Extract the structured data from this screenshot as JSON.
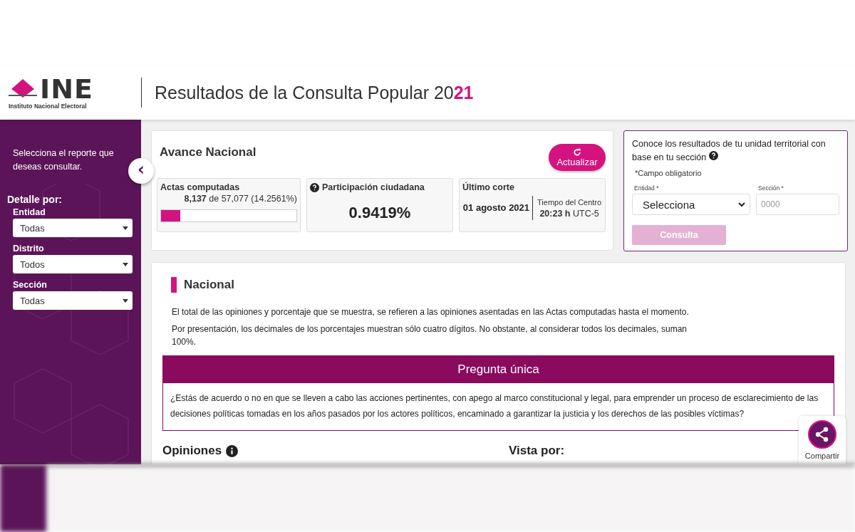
{
  "header": {
    "logo_text": "INE",
    "logo_caption": "Instituto Nacional Electoral",
    "title": "Resultados de la Consulta Popular 20",
    "title_accent": "21"
  },
  "sidebar": {
    "intro": "Selecciona el reporte que deseas consultar.",
    "collapse_icon": "‹",
    "heading": "Detalle por:",
    "filters": [
      {
        "label": "Entidad",
        "value": "Todas"
      },
      {
        "label": "Distrito",
        "value": "Todos"
      },
      {
        "label": "Sección",
        "value": "Todas"
      }
    ]
  },
  "avance": {
    "title": "Avance Nacional",
    "refresh_button": "Actualizar",
    "actas": {
      "label": "Actas computadas",
      "reading": "**8,137** de 57,077 (14.2561%)",
      "level": 0.1426
    },
    "participacion": {
      "label": "Participación ciudadana",
      "value": "0.9419%"
    },
    "corte": {
      "label": "Último corte",
      "date": "01 agosto 2021",
      "zone_label": "Tiempo del Centro",
      "time": "**20:23 h** UTC-5"
    }
  },
  "consulta": {
    "title": "Conoce los resultados de tu unidad territorial con base en tu sección",
    "note": "*Campo obligatorio",
    "entidad_label": "Entidad *",
    "entidad_value": "Selecciona",
    "seccion_label": "Sección *",
    "seccion_placeholder": "0000",
    "button": "Consulta",
    "button_disabled": true
  },
  "nacional": {
    "title": "Nacional",
    "paragraphs": [
      "El total de las opiniones y porcentaje que se muestra, se refieren a las opiniones asentadas en las Actas computadas hasta el momento.",
      "Por presentación, los decimales de los porcentajes muestran sólo cuatro dígitos. No obstante, al considerar todos los decimales, suman 100%."
    ],
    "question_title": "Pregunta única",
    "question": "¿Estás de acuerdo o no en que se lleven a cabo las acciones pertinentes, con apego al marco constitucional y legal, para emprender un proceso de esclarecimiento de las decisiones políticas tomadas en los años pasados por los actores políticos, encaminado a garantizar la justicia y los derechos de las posibles víctimas?",
    "opiniones_label": "Opiniones",
    "vista_label": "Vista por:"
  },
  "share": {
    "label": "Compartir"
  }
}
